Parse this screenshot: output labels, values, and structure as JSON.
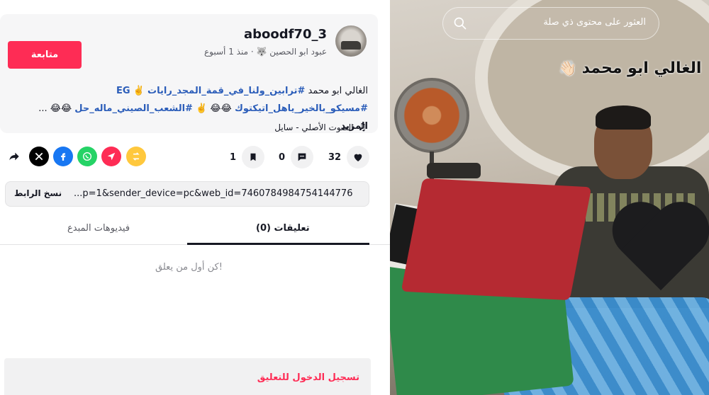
{
  "post": {
    "username": "aboodf70_3",
    "display_name": "عبود ابو الحصين",
    "time_ago": "منذ 1 أسبوع",
    "follow_label": "متابعة",
    "description_line1_text": "الغالي ابو محمد ",
    "description_line1_tag": "#ترابين_ولنا_في_قمة_المجد_رايات",
    "description_line1_emoji": "✌️",
    "description_line1_tag2": "EG",
    "description_line2_tag1": "#مسيكو_بالخير_ياهل_اتيكتوك",
    "description_line2_emoji1": "😂😂",
    "description_line2_emoji2": "✌️",
    "description_line2_tag2": "#الشعب_الصيني_ماله_حل",
    "description_line2_emoji3": "😂😂",
    "description_ellipsis": "...",
    "more_label": "المزيد",
    "music_label": "الصوت الأصلي - سايل"
  },
  "actions": {
    "likes": "32",
    "comments": "0",
    "saves": "1"
  },
  "link": {
    "url": "...p=1&sender_device=pc&web_id=7460784984754144776",
    "copy_label": "نسخ الرابط"
  },
  "tabs": {
    "comments_label": "تعليقات (0)",
    "creator_videos_label": "فيديوهات المبدع"
  },
  "comments": {
    "empty_text": "كن أول من يعلق!"
  },
  "login": {
    "prompt": "تسجيل الدخول للتعليق"
  },
  "video": {
    "search_placeholder": "العثور على محتوى ذي صلة",
    "overlay_text": "الغالي ابو محمد"
  },
  "colors": {
    "accent": "#fe2c55",
    "hashtag": "#2b5db9",
    "facebook": "#1877f2",
    "whatsapp": "#25d366",
    "x": "#000000",
    "telegram_like": "#fe2c55",
    "repost": "#ffc83d"
  },
  "icons": [
    "heart-icon",
    "comment-icon",
    "bookmark-icon",
    "repost-icon",
    "share-arrow-icon",
    "whatsapp-icon",
    "facebook-icon",
    "x-icon",
    "forward-icon",
    "music-note-icon",
    "search-icon",
    "verified-wave-icon"
  ]
}
